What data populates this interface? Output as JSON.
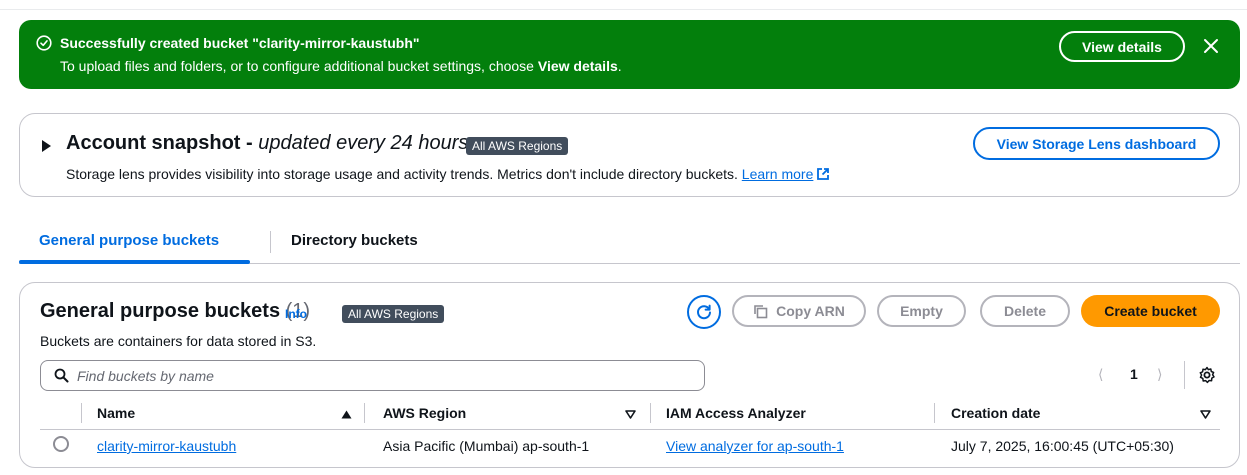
{
  "flash": {
    "title": "Successfully created bucket \"clarity-mirror-kaustubh\"",
    "message_prefix": "To upload files and folders, or to configure additional bucket settings, choose ",
    "message_emphasis": "View details",
    "message_suffix": ".",
    "view_details_label": "View details",
    "color": "#037f0c"
  },
  "snapshot": {
    "title_bold": "Account snapshot - ",
    "title_italic": "updated every 24 hours",
    "badge": "All AWS Regions",
    "description": "Storage lens provides visibility into storage usage and activity trends. Metrics don't include directory buckets. ",
    "learn_more": "Learn more",
    "lens_button": "View Storage Lens dashboard"
  },
  "tabs": [
    {
      "label": "General purpose buckets",
      "active": true
    },
    {
      "label": "Directory buckets",
      "active": false
    }
  ],
  "buckets": {
    "heading": "General purpose buckets",
    "count": "(1)",
    "info": "Info",
    "badge": "All AWS Regions",
    "subtitle": "Buckets are containers for data stored in S3.",
    "copy_arn": "Copy ARN",
    "empty": "Empty",
    "delete": "Delete",
    "create": "Create bucket",
    "search_placeholder": "Find buckets by name",
    "page": "1",
    "columns": [
      "Name",
      "AWS Region",
      "IAM Access Analyzer",
      "Creation date"
    ],
    "rows": [
      {
        "name": "clarity-mirror-kaustubh",
        "region": "Asia Pacific (Mumbai) ap-south-1",
        "analyzer": "View analyzer for ap-south-1",
        "created": "July 7, 2025, 16:00:45 (UTC+05:30)"
      }
    ]
  },
  "colors": {
    "link": "#006ce0",
    "primary": "#ff9900",
    "badge_bg": "#414d5c"
  }
}
